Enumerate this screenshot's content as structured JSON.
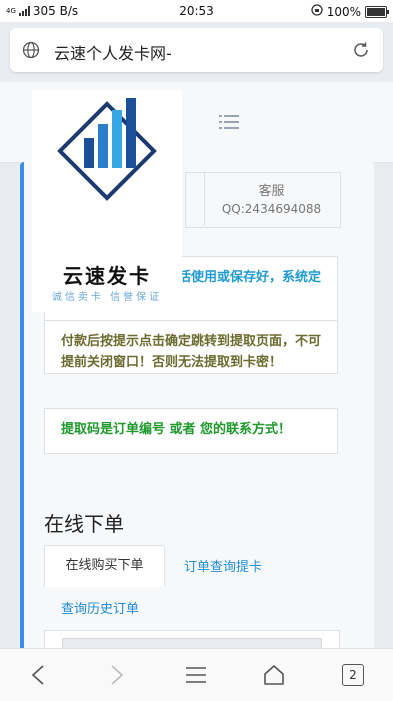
{
  "status_bar": {
    "network": "4G",
    "speed": "305 B/s",
    "time": "20:53",
    "battery": "100%"
  },
  "browser": {
    "page_title": "云速个人发卡网-",
    "tabs_count": "2"
  },
  "header": {
    "logo_text": "云速发卡",
    "logo_slogan": "诚信卖卡 信誉保证"
  },
  "contact": {
    "label": "客服",
    "value": "QQ:2434694088"
  },
  "notices": {
    "activate": "提取卡密后请尽快激活使用或保存好，系统定期清除被提取的卡密",
    "payment": "付款后按提示点击确定跳转到提取页面，不可提前关闭窗口！否则无法提取到卡密！",
    "code": "提取码是订单编号 或者 您的联系方式！"
  },
  "order": {
    "title": "在线下单",
    "tabs": [
      "在线购买下单",
      "订单查询提卡",
      "查询历史订单"
    ]
  },
  "colors": {
    "accent": "#3a8ee6",
    "notice_blue": "#1f9bd4",
    "notice_olive": "#6b6b2f",
    "notice_green": "#1e9a2c",
    "link": "#1f8bd4"
  }
}
